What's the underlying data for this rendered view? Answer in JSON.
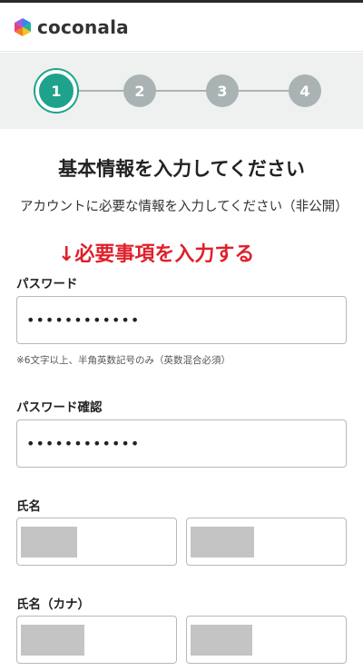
{
  "app": {
    "logo_text": "coconala",
    "logo_icon": "coconala-logo-icon",
    "brand_color": "#1fa28c"
  },
  "stepper": {
    "steps": [
      "1",
      "2",
      "3",
      "4"
    ],
    "current_step": 1,
    "active_color": "#1fa28c",
    "inactive_color": "#a9b3b3"
  },
  "form": {
    "title": "基本情報を入力してください",
    "subtitle": "アカウントに必要な情報を入力してください（非公開）",
    "annotation": "↓必要事項を入力する",
    "annotation_color": "#e0202a",
    "password": {
      "label": "パスワード",
      "value": "••••••••••••",
      "hint": "※6文字以上、半角英数記号のみ（英数混合必須）"
    },
    "password_confirm": {
      "label": "パスワード確認",
      "value": "••••••••••••"
    },
    "name": {
      "label": "氏名"
    },
    "name_kana": {
      "label": "氏名（カナ）"
    }
  }
}
